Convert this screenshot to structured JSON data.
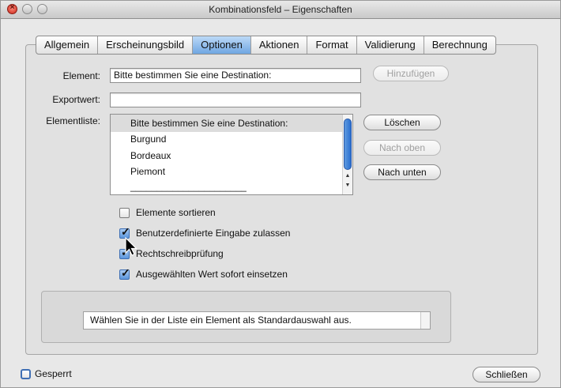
{
  "window": {
    "title": "Kombinationsfeld – Eigenschaften"
  },
  "tabs": [
    {
      "label": "Allgemein",
      "active": false
    },
    {
      "label": "Erscheinungsbild",
      "active": false
    },
    {
      "label": "Optionen",
      "active": true
    },
    {
      "label": "Aktionen",
      "active": false
    },
    {
      "label": "Format",
      "active": false
    },
    {
      "label": "Validierung",
      "active": false
    },
    {
      "label": "Berechnung",
      "active": false
    }
  ],
  "form": {
    "element_label": "Element:",
    "element_value": "Bitte bestimmen Sie eine Destination:",
    "exportwert_label": "Exportwert:",
    "exportwert_value": "",
    "elementliste_label": "Elementliste:",
    "hinzufuegen_button": "Hinzufügen",
    "loeschen_button": "Löschen",
    "nach_oben_button": "Nach oben",
    "nach_unten_button": "Nach unten"
  },
  "list_items": [
    "Bitte bestimmen Sie eine Destination:",
    "Burgund",
    "Bordeaux",
    "Piemont",
    "______________________"
  ],
  "checkboxes": [
    {
      "label": "Elemente sortieren",
      "checked": false
    },
    {
      "label": "Benutzerdefinierte Eingabe zulassen",
      "checked": true
    },
    {
      "label": "Rechtschreibprüfung",
      "checked": true
    },
    {
      "label": "Ausgewählten Wert sofort einsetzen",
      "checked": true
    }
  ],
  "info_text": "Wählen Sie in der Liste ein Element als Standardauswahl aus.",
  "footer": {
    "gesperrt_label": "Gesperrt",
    "gesperrt_checked": false,
    "close_button": "Schließen"
  },
  "colors": {
    "selection_blue": "#6fa6e2",
    "scroll_thumb": "#2a6fd0"
  }
}
